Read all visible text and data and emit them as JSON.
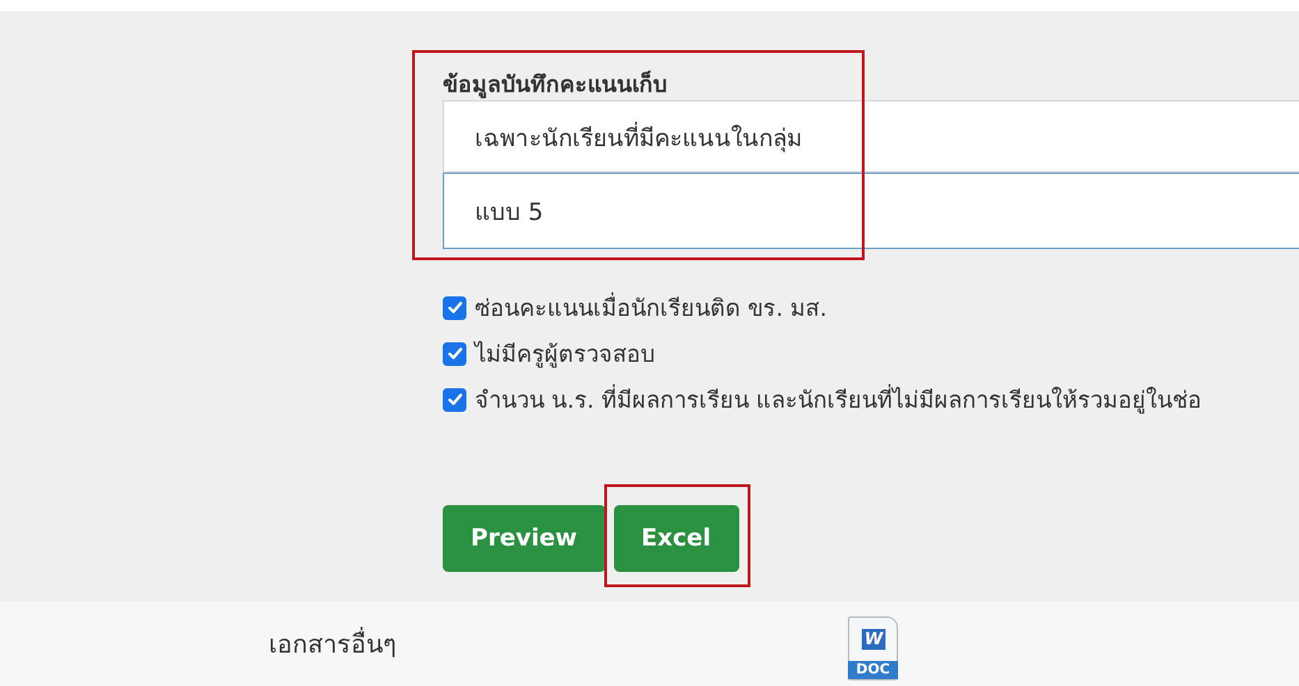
{
  "score_section": {
    "label": "ข้อมูลบันทึกคะแนนเก็บ",
    "highlighted": true,
    "selects": [
      {
        "value": "เฉพาะนักเรียนที่มีคะแนนในกลุ่ม",
        "focused": false
      },
      {
        "value": "แบบ 5",
        "focused": true
      }
    ]
  },
  "options": [
    {
      "label": "ซ่อนคะแนนเมื่อนักเรียนติด ขร. มส.",
      "checked": true
    },
    {
      "label": "ไม่มีครูผู้ตรวจสอบ",
      "checked": true
    },
    {
      "label": "จำนวน น.ร. ที่มีผลการเรียน และนักเรียนที่ไม่มีผลการเรียนให้รวมอยู่ในช่อ",
      "checked": true
    }
  ],
  "buttons": [
    {
      "label": "Preview",
      "highlighted": false
    },
    {
      "label": "Excel",
      "highlighted": true
    }
  ],
  "documents": {
    "label": "เอกสารอื่นๆ",
    "file_icon": {
      "letter": "W",
      "type": "DOC"
    }
  }
}
